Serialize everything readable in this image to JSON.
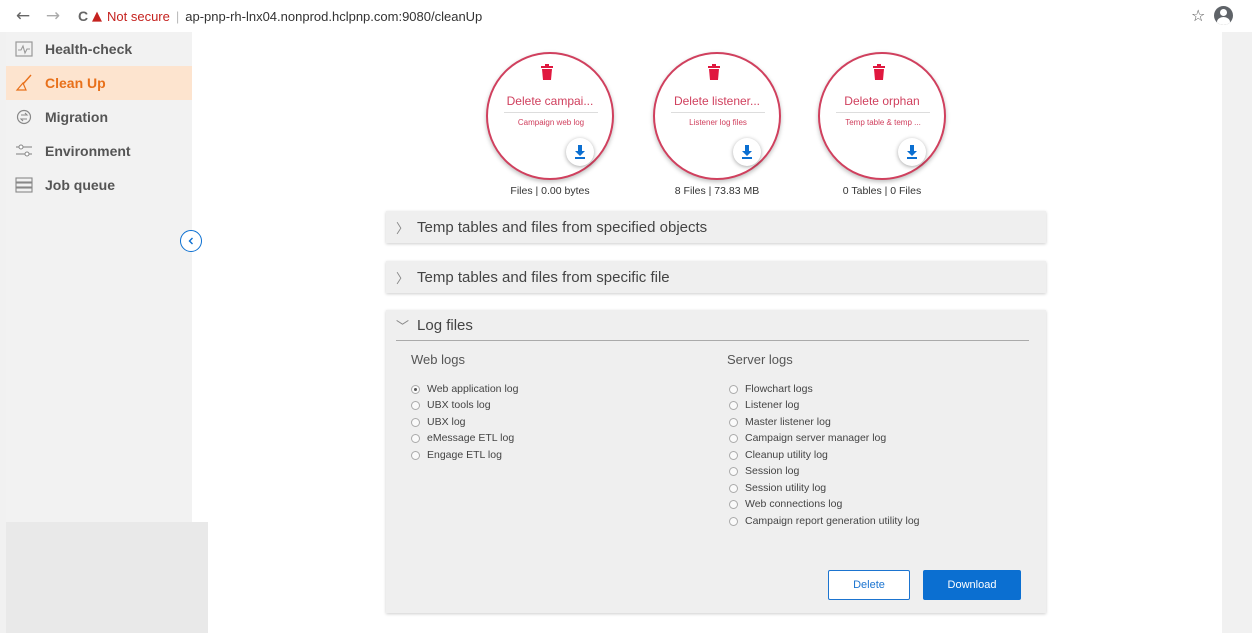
{
  "browser": {
    "back": "←",
    "forward": "→",
    "reload": "C",
    "warning": "▲",
    "not_secure": "Not secure",
    "separator": "|",
    "url": "ap-pnp-rh-lnx04.nonprod.hclpnp.com:9080/cleanUp",
    "star": "☆"
  },
  "sidebar": {
    "items": [
      {
        "label": "Health-check"
      },
      {
        "label": "Clean Up"
      },
      {
        "label": "Migration"
      },
      {
        "label": "Environment"
      },
      {
        "label": "Job queue"
      }
    ]
  },
  "cleanup_cards": [
    {
      "title": "Delete campai...",
      "subtitle": "Campaign web log",
      "caption": "Files | 0.00 bytes"
    },
    {
      "title": "Delete listener...",
      "subtitle": "Listener log files",
      "caption": "8 Files | 73.83 MB"
    },
    {
      "title": "Delete orphan",
      "subtitle": "Temp table & temp ...",
      "caption": "0 Tables | 0 Files"
    }
  ],
  "sections": {
    "specified_objects": "Temp tables and files from specified objects",
    "specific_file": "Temp tables and files from specific file",
    "log_files": "Log files"
  },
  "chevrons": {
    "collapsed": "〉",
    "expanded": "﹀"
  },
  "log_files": {
    "web_logs_title": "Web logs",
    "web_logs": [
      "Web application log",
      "UBX tools log",
      "UBX log",
      "eMessage ETL log",
      "Engage ETL log"
    ],
    "server_logs_title": "Server logs",
    "server_logs": [
      "Flowchart logs",
      "Listener log",
      "Master listener log",
      "Campaign server manager log",
      "Cleanup utility log",
      "Session log",
      "Session utility log",
      "Web connections log",
      "Campaign report generation utility log"
    ],
    "delete_label": "Delete",
    "download_label": "Download"
  },
  "colors": {
    "accent": "#e8701a",
    "primary": "#0b6fd1",
    "danger": "#d0405e"
  }
}
